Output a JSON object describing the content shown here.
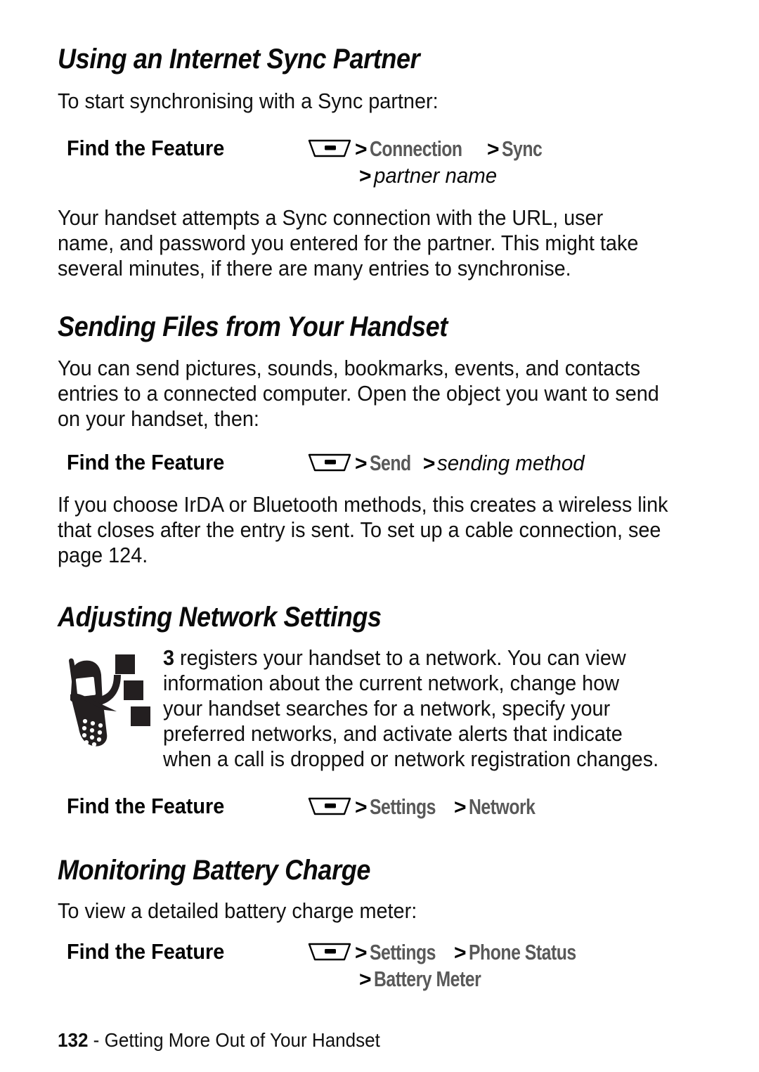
{
  "page": {
    "number": "132",
    "footer_separator": " - ",
    "footer_text": "Getting More Out of Your Handset"
  },
  "sections": [
    {
      "id": "using-internet-sync-partner",
      "heading": "Using an Internet Sync Partner",
      "intro": "To start synchronising with a Sync partner:",
      "find_the_feature": {
        "label": "Find the Feature",
        "icon": "menu-key-icon",
        "line1": [
          {
            "type": "separator",
            "text": ">"
          },
          {
            "type": "menu",
            "text": "Connection"
          },
          {
            "type": "separator",
            "text": ">"
          },
          {
            "type": "menu",
            "text": "Sync"
          }
        ],
        "line2": [
          {
            "type": "separator",
            "text": ">"
          },
          {
            "type": "placeholder",
            "text": "partner name"
          }
        ]
      },
      "body": "Your handset attempts a Sync connection with the URL, user name, and password you entered for the partner. This might take several minutes, if there are many entries to synchronise."
    },
    {
      "id": "sending-files-from-your-handset",
      "heading": "Sending Files from Your Handset",
      "intro": "You can send pictures, sounds, bookmarks, events, and contacts entries to a connected computer. Open the object you want to send on your handset, then:",
      "find_the_feature": {
        "label": "Find the Feature",
        "icon": "menu-key-icon",
        "line1": [
          {
            "type": "separator",
            "text": ">"
          },
          {
            "type": "menu",
            "text": "Send"
          },
          {
            "type": "separator",
            "text": ">"
          },
          {
            "type": "placeholder",
            "text": "sending method"
          }
        ]
      },
      "body": "If you choose IrDA or Bluetooth methods, this creates a wireless link that closes after the entry is sent. To set up a cable connection, see page 124."
    },
    {
      "id": "adjusting-network-settings",
      "heading": "Adjusting Network Settings",
      "icon": "network-handset-icon",
      "body_lead": "3",
      "body": " registers your handset to a network. You can view information about the current network, change how your handset searches for a network, specify your preferred networks, and activate alerts that indicate when a call is dropped or network registration changes.",
      "find_the_feature": {
        "label": "Find the Feature",
        "icon": "menu-key-icon",
        "line1": [
          {
            "type": "separator",
            "text": ">"
          },
          {
            "type": "menu",
            "text": "Settings"
          },
          {
            "type": "separator",
            "text": ">"
          },
          {
            "type": "menu",
            "text": "Network"
          }
        ]
      }
    },
    {
      "id": "monitoring-battery-charge",
      "heading": "Monitoring Battery Charge",
      "intro": "To view a detailed battery charge meter:",
      "find_the_feature": {
        "label": "Find the Feature",
        "icon": "menu-key-icon",
        "line1": [
          {
            "type": "separator",
            "text": ">"
          },
          {
            "type": "menu",
            "text": "Settings"
          },
          {
            "type": "separator",
            "text": ">"
          },
          {
            "type": "menu",
            "text": "Phone Status"
          }
        ],
        "line2": [
          {
            "type": "separator",
            "text": ">"
          },
          {
            "type": "menu",
            "text": "Battery Meter"
          }
        ]
      }
    }
  ],
  "colors": {
    "text": "#101010",
    "menu_path": "#595959",
    "background": "#ffffff"
  }
}
